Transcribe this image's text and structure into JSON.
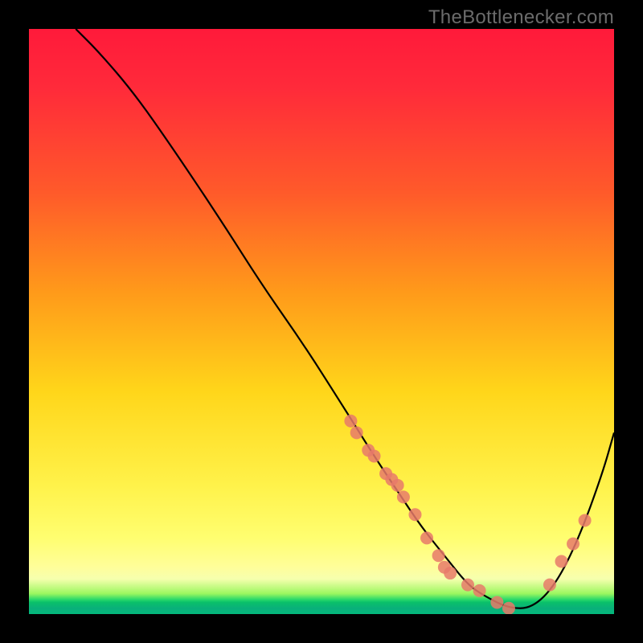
{
  "watermark": "TheBottlenecker.com",
  "chart_data": {
    "type": "line",
    "title": "",
    "xlabel": "",
    "ylabel": "",
    "xlim": [
      0,
      100
    ],
    "ylim": [
      0,
      100
    ],
    "curve": {
      "name": "bottleneck-curve",
      "x": [
        8,
        12,
        18,
        25,
        33,
        40,
        47,
        54,
        59,
        63,
        67,
        71,
        75,
        78,
        82,
        86,
        90,
        94,
        98,
        100
      ],
      "y": [
        100,
        96,
        89,
        79,
        67,
        56,
        46,
        35,
        27,
        21,
        15,
        10,
        5,
        3,
        1,
        1,
        5,
        13,
        24,
        31
      ]
    },
    "points": {
      "name": "highlighted-points",
      "x": [
        55,
        56,
        58,
        59,
        61,
        62,
        63,
        64,
        66,
        68,
        70,
        71,
        72,
        75,
        77,
        80,
        82,
        89,
        91,
        93,
        95
      ],
      "y": [
        33,
        31,
        28,
        27,
        24,
        23,
        22,
        20,
        17,
        13,
        10,
        8,
        7,
        5,
        4,
        2,
        1,
        5,
        9,
        12,
        16
      ],
      "radius": 8
    }
  }
}
